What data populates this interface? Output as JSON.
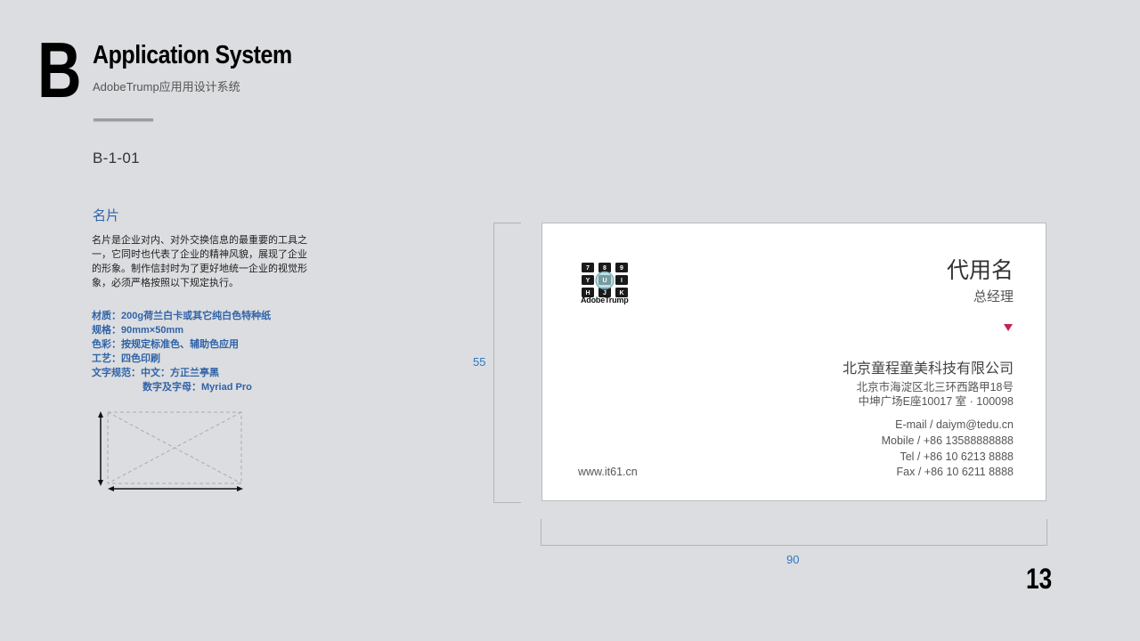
{
  "header": {
    "letter": "B",
    "title": "Application System",
    "subtitle": "AdobeTrump应用用设计系统",
    "section_code": "B-1-01"
  },
  "content": {
    "heading": "名片",
    "paragraph": "名片是企业对内、对外交换信息的最重要的工具之一，它同时也代表了企业的精神风貌，展现了企业的形象。制作信封时为了更好地统一企业的视觉形象，必须严格按照以下规定执行。",
    "specs": [
      "材质：200g荷兰白卡或其它纯白色特种纸",
      "规格：90mm×50mm",
      "色彩：按规定标准色、辅助色应用",
      "工艺：四色印刷",
      "文字规范：中文：方正兰亭黑"
    ],
    "spec_extra": "数字及字母：Myriad Pro"
  },
  "dimensions": {
    "height_label": "55",
    "width_label": "90"
  },
  "card": {
    "logo_text": "AdobeTrump",
    "logo_keys": [
      "7",
      "8",
      "9",
      "Y",
      "U",
      "I",
      "H",
      "J",
      "K"
    ],
    "name": "代用名",
    "position": "总经理",
    "company": "北京童程童美科技有限公司",
    "address_line1": "北京市海淀区北三环西路甲18号",
    "address_line2": "中坤广场E座10017 室 · 100098",
    "email": "E-mail / daiym@tedu.cn",
    "mobile": "Mobile / +86 13588888888",
    "tel": "Tel / +86 10 6213 8888",
    "fax": "Fax / +86 10 6211 8888",
    "website": "www.it61.cn",
    "accent_color": "#c6224f"
  },
  "page_number": "13"
}
